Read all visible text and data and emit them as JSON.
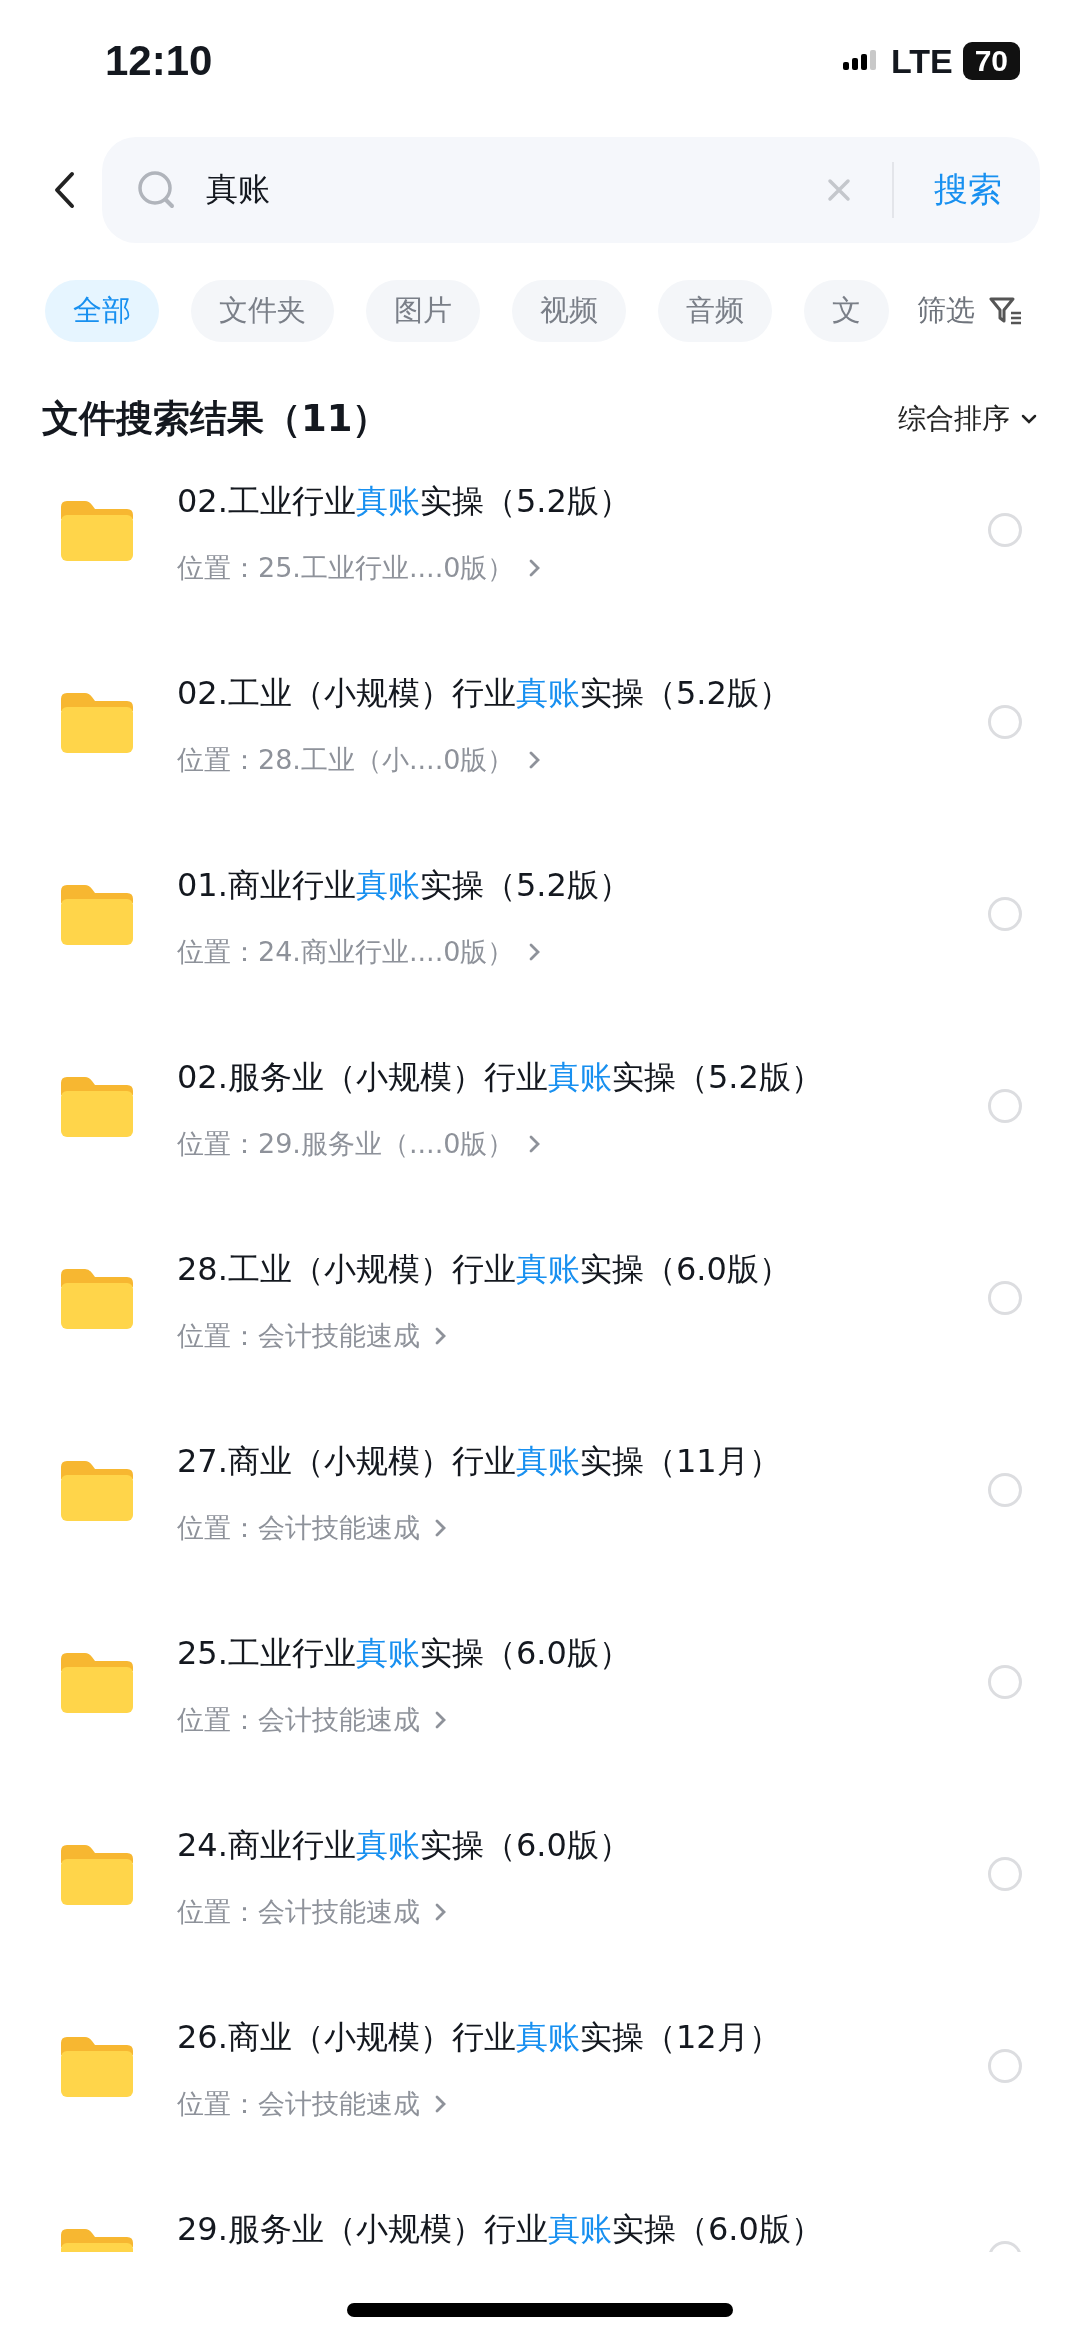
{
  "status_bar": {
    "time": "12:10",
    "network": "LTE",
    "battery": "70"
  },
  "search": {
    "value": "真账",
    "button": "搜索"
  },
  "tabs": [
    {
      "label": "全部",
      "selected": true
    },
    {
      "label": "文件夹",
      "selected": false
    },
    {
      "label": "图片",
      "selected": false
    },
    {
      "label": "视频",
      "selected": false
    },
    {
      "label": "音频",
      "selected": false
    },
    {
      "label": "文",
      "selected": false
    }
  ],
  "filter": {
    "label": "筛选"
  },
  "results": {
    "title": "文件搜索结果（11）",
    "sort": "综合排序",
    "items": [
      {
        "title": [
          {
            "text": "02.工业行业",
            "highlighted": false
          },
          {
            "text": "真账",
            "highlighted": true
          },
          {
            "text": "实操（5.2版）",
            "highlighted": false
          }
        ],
        "location": "位置：25.工业行业....0版）",
        "selected": false
      },
      {
        "title": [
          {
            "text": "02.工业（小规模）行业",
            "highlighted": false
          },
          {
            "text": "真账",
            "highlighted": true
          },
          {
            "text": "实操（5.2版）",
            "highlighted": false
          }
        ],
        "location": "位置：28.工业（小....0版）",
        "selected": false
      },
      {
        "title": [
          {
            "text": "01.商业行业",
            "highlighted": false
          },
          {
            "text": "真账",
            "highlighted": true
          },
          {
            "text": "实操（5.2版）",
            "highlighted": false
          }
        ],
        "location": "位置：24.商业行业....0版）",
        "selected": false
      },
      {
        "title": [
          {
            "text": "02.服务业（小规模）行业",
            "highlighted": false
          },
          {
            "text": "真账",
            "highlighted": true
          },
          {
            "text": "实操（5.2版）",
            "highlighted": false
          }
        ],
        "location": "位置：29.服务业（....0版）",
        "selected": false
      },
      {
        "title": [
          {
            "text": "28.工业（小规模）行业",
            "highlighted": false
          },
          {
            "text": "真账",
            "highlighted": true
          },
          {
            "text": "实操（6.0版）",
            "highlighted": false
          }
        ],
        "location": "位置：会计技能速成",
        "selected": false
      },
      {
        "title": [
          {
            "text": "27.商业（小规模）行业",
            "highlighted": false
          },
          {
            "text": "真账",
            "highlighted": true
          },
          {
            "text": "实操（11月）",
            "highlighted": false
          }
        ],
        "location": "位置：会计技能速成",
        "selected": false
      },
      {
        "title": [
          {
            "text": "25.工业行业",
            "highlighted": false
          },
          {
            "text": "真账",
            "highlighted": true
          },
          {
            "text": "实操（6.0版）",
            "highlighted": false
          }
        ],
        "location": "位置：会计技能速成",
        "selected": false
      },
      {
        "title": [
          {
            "text": "24.商业行业",
            "highlighted": false
          },
          {
            "text": "真账",
            "highlighted": true
          },
          {
            "text": "实操（6.0版）",
            "highlighted": false
          }
        ],
        "location": "位置：会计技能速成",
        "selected": false
      },
      {
        "title": [
          {
            "text": "26.商业（小规模）行业",
            "highlighted": false
          },
          {
            "text": "真账",
            "highlighted": true
          },
          {
            "text": "实操（12月）",
            "highlighted": false
          }
        ],
        "location": "位置：会计技能速成",
        "selected": false
      },
      {
        "title": [
          {
            "text": "29.服务业（小规模）行业",
            "highlighted": false
          },
          {
            "text": "真账",
            "highlighted": true
          },
          {
            "text": "实操（6.0版）",
            "highlighted": false
          }
        ],
        "selected": false
      }
    ]
  }
}
